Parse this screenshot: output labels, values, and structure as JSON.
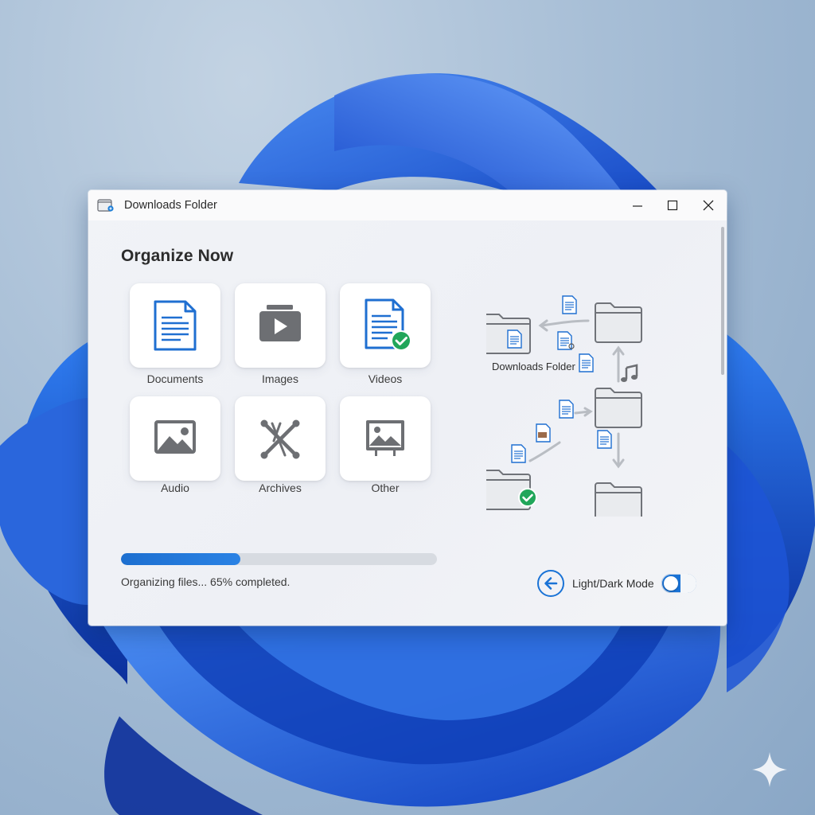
{
  "window": {
    "title": "Downloads Folder",
    "controls": {
      "minimize": "minimize",
      "maximize": "maximize",
      "close": "close"
    }
  },
  "main": {
    "heading": "Organize Now",
    "categories": [
      {
        "label": "Documents",
        "icon": "document-icon"
      },
      {
        "label": "Images",
        "icon": "video-play-icon"
      },
      {
        "label": "Videos",
        "icon": "document-check-icon"
      },
      {
        "label": "Audio",
        "icon": "image-icon"
      },
      {
        "label": "Archives",
        "icon": "archive-icon"
      },
      {
        "label": "Other",
        "icon": "picture-frame-icon"
      }
    ],
    "progress": {
      "percent": 65,
      "status": "Organizing files... 65% completed."
    }
  },
  "diagram": {
    "label": "Downloads Folder"
  },
  "footer": {
    "mode_label": "Light/Dark Mode",
    "toggle_on": true
  },
  "colors": {
    "accent": "#1a73d6",
    "check_green": "#21a65a",
    "icon_gray": "#6d6f73",
    "doc_blue": "#1f6fd1"
  }
}
